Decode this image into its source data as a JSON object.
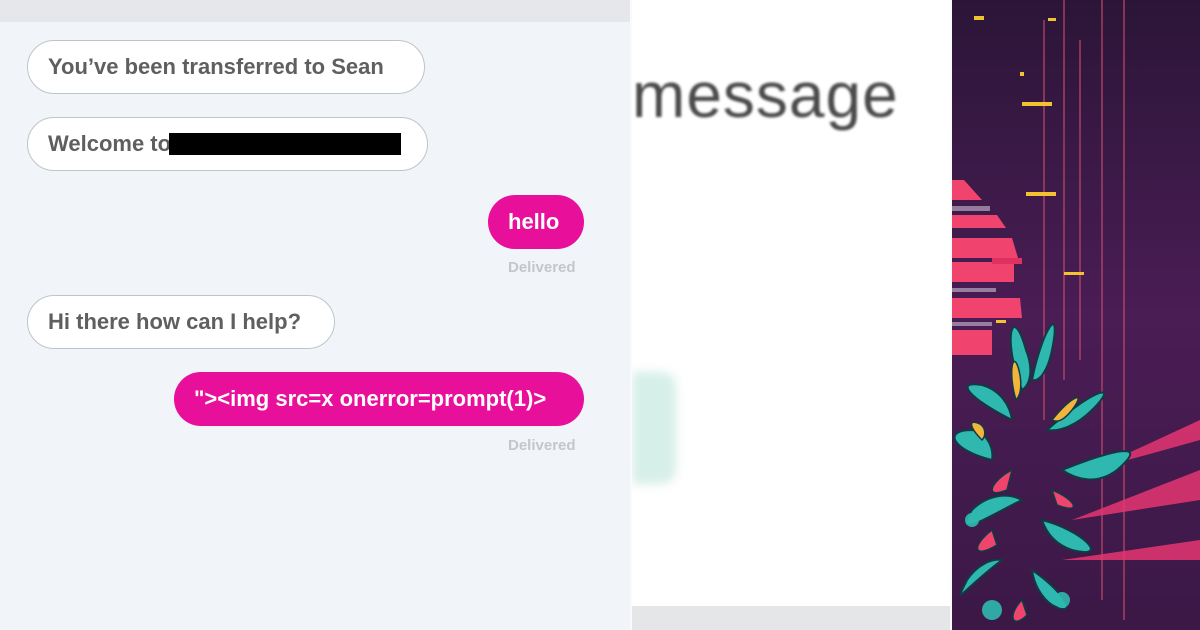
{
  "chat": {
    "messages": [
      {
        "sender": "agent",
        "text": "You’ve been transferred to Sean"
      },
      {
        "sender": "agent",
        "text": "Welcome to"
      },
      {
        "sender": "user",
        "text": "hello",
        "status": "Delivered"
      },
      {
        "sender": "agent",
        "text": "Hi there how can I help?"
      },
      {
        "sender": "user",
        "text": "\"><img src=x onerror=prompt(1)>",
        "status": "Delivered"
      }
    ]
  },
  "zoom": {
    "text": "message"
  },
  "colors": {
    "user_bubble": "#e8109a",
    "agent_bubble_border": "#bfc4c9",
    "chat_background": "#f1f5f9",
    "art_background": "#3a1a4a",
    "art_pink": "#f0446e",
    "art_teal": "#2fb8b0",
    "art_yellow": "#f2c230"
  }
}
